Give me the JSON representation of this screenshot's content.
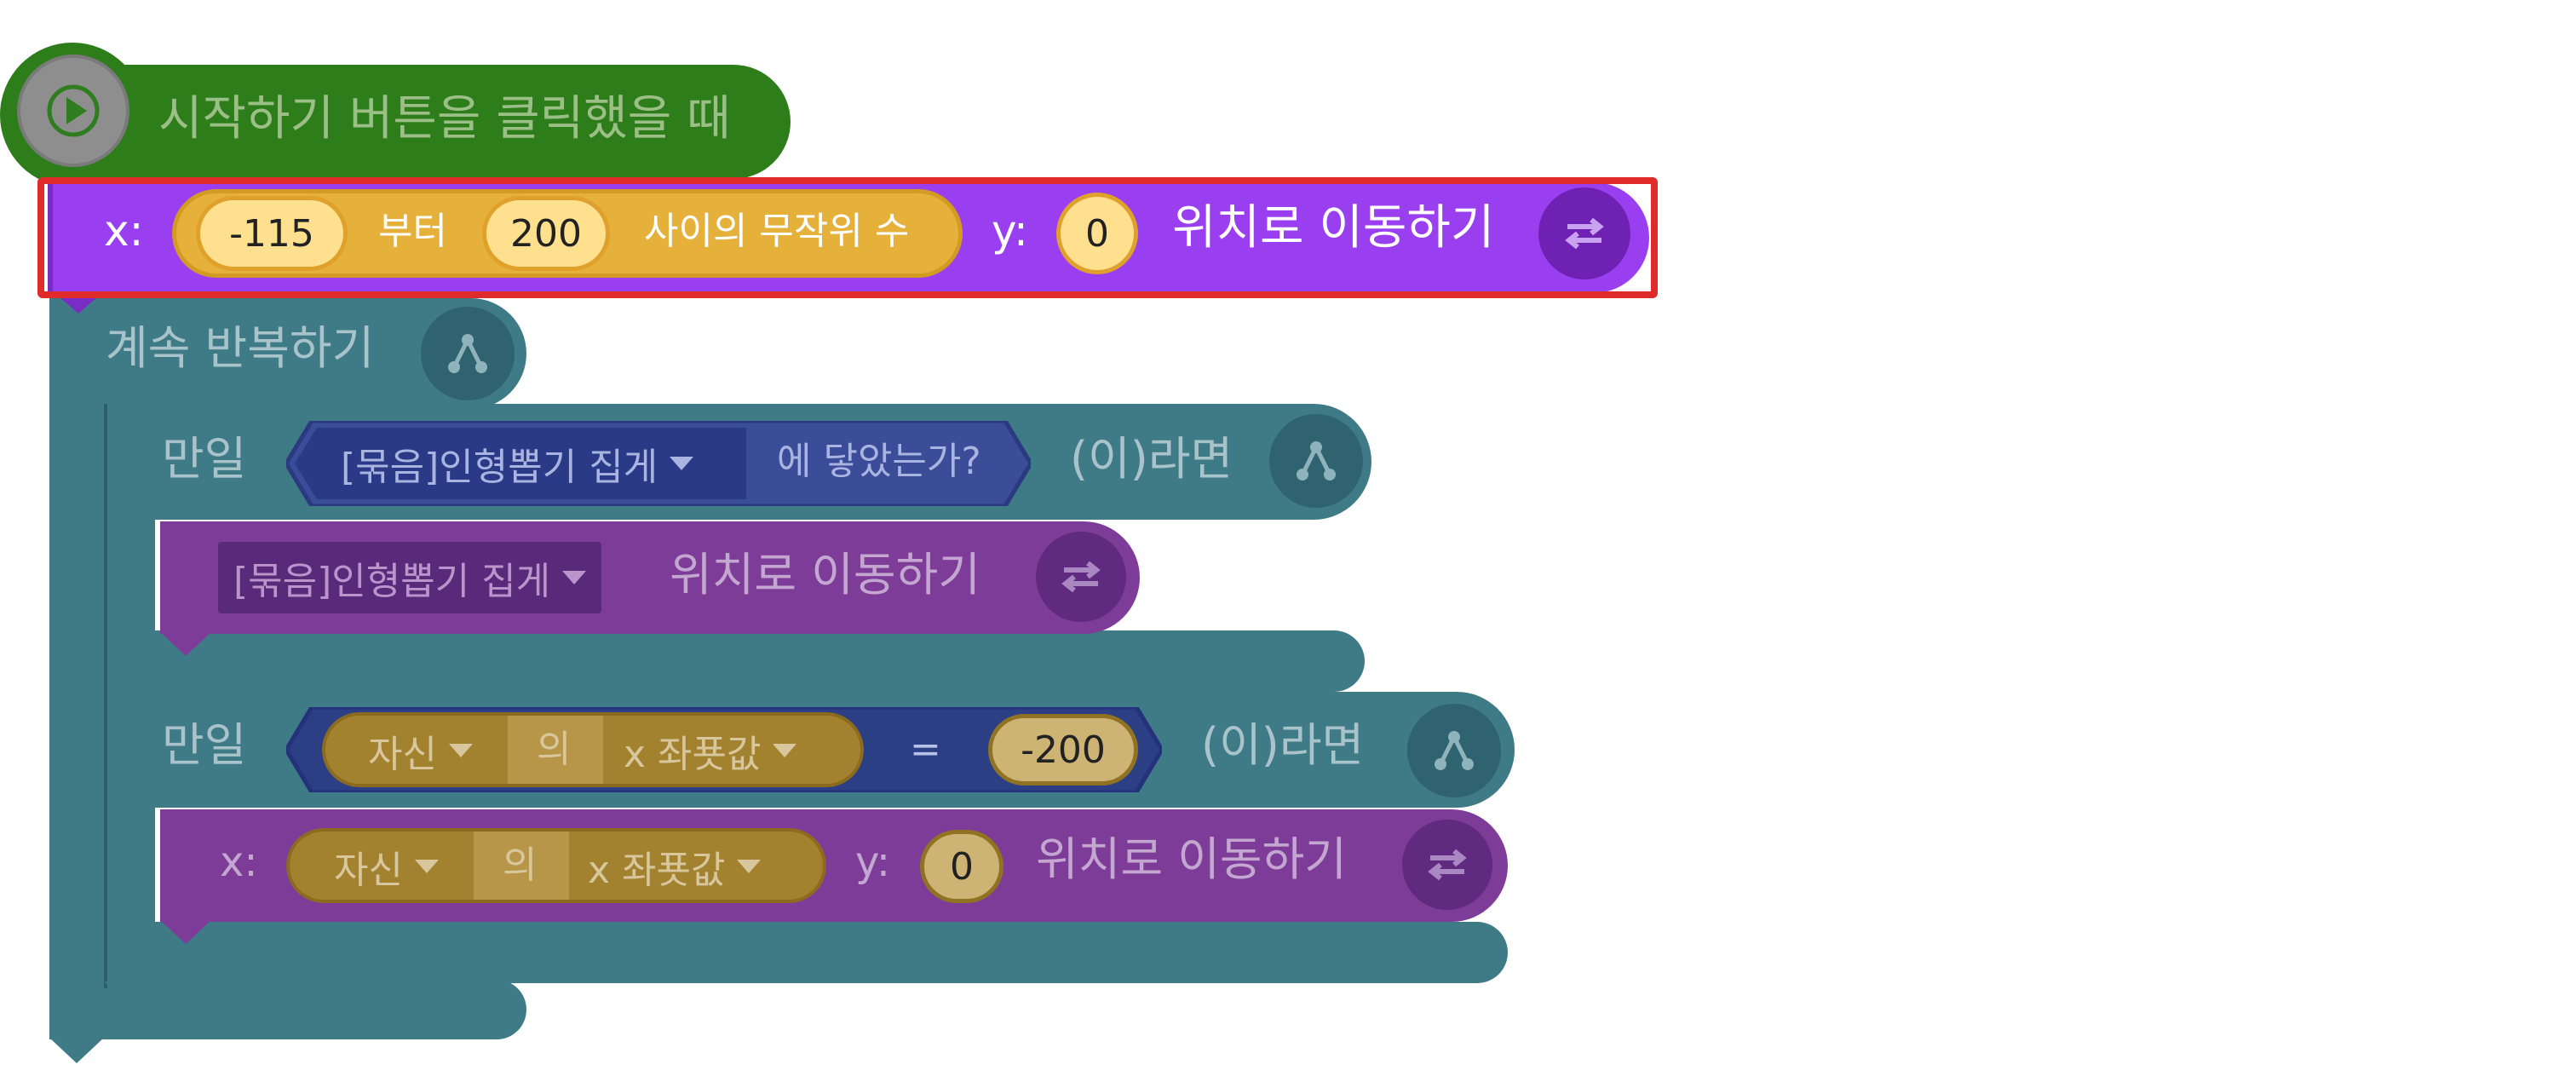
{
  "colors": {
    "start_green": "#2e7d1b",
    "start_green_text": "#9bbf86",
    "motion_purple": "#9a3ff0",
    "motion_purple_dim": "#7d3c98",
    "operator_yellow": "#e6b13b",
    "flow_teal": "#3f7b87",
    "selection_red": "#e02b2b",
    "bool_navy": "#2f3f8a"
  },
  "start_block": {
    "icon": "play-icon",
    "label": "시작하기 버튼을 클릭했을 때"
  },
  "selected_block": {
    "x_label": "x:",
    "random_from": "-115",
    "random_from_label": "부터",
    "random_to": "200",
    "random_suffix": "사이의 무작위 수",
    "y_label": "y:",
    "y_value": "0",
    "action_label": "위치로 이동하기",
    "icon": "swap-arrows-icon"
  },
  "forever_block": {
    "label": "계속 반복하기",
    "icon": "branch-icon"
  },
  "if_block_1": {
    "if_label": "만일",
    "target_dropdown": "[묶음]인형뽑기 집게",
    "condition_suffix": "에 닿았는가?",
    "then_label": "(이)라면",
    "icon": "branch-icon"
  },
  "move_to_object_block": {
    "target_dropdown": "[묶음]인형뽑기 집게",
    "action_label": "위치로 이동하기",
    "icon": "swap-arrows-icon"
  },
  "if_block_2": {
    "if_label": "만일",
    "object_dropdown": "자신",
    "of_label": "의",
    "property_dropdown": "x 좌푯값",
    "operator": "=",
    "compare_value": "-200",
    "then_label": "(이)라면",
    "icon": "branch-icon"
  },
  "move_xy_block": {
    "x_label": "x:",
    "object_dropdown": "자신",
    "of_label": "의",
    "property_dropdown": "x 좌푯값",
    "y_label": "y:",
    "y_value": "0",
    "action_label": "위치로 이동하기",
    "icon": "swap-arrows-icon"
  }
}
